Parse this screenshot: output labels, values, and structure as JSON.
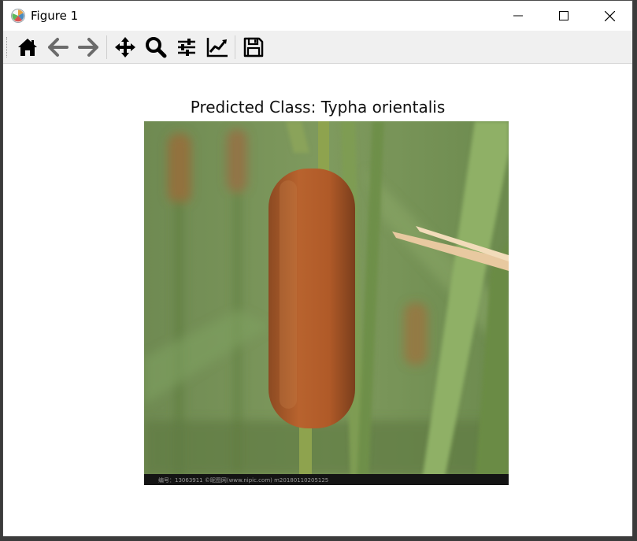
{
  "window": {
    "title": "Figure 1",
    "controls": [
      "minimize",
      "maximize",
      "close"
    ]
  },
  "toolbar": {
    "buttons": [
      {
        "icon": "home-icon",
        "action": "Home"
      },
      {
        "icon": "arrow-left-icon",
        "action": "Back"
      },
      {
        "icon": "arrow-right-icon",
        "action": "Forward"
      },
      {
        "icon": "move-icon",
        "action": "Pan"
      },
      {
        "icon": "zoom-icon",
        "action": "Zoom"
      },
      {
        "icon": "sliders-icon",
        "action": "Subplots"
      },
      {
        "icon": "line-chart-icon",
        "action": "Customize"
      },
      {
        "icon": "save-icon",
        "action": "Save"
      }
    ]
  },
  "figure": {
    "title": "Predicted Class: Typha orientalis",
    "image": {
      "subject": "cattail",
      "caption_strip": "编号：13063911 ©昵图网(www.nipic.com) m20180110205125"
    }
  },
  "colors": {
    "toolbar_bg": "#f0f0f0",
    "window_bg": "#ffffff",
    "cattail": "#b0582a",
    "foliage": "#6e8c4a"
  }
}
